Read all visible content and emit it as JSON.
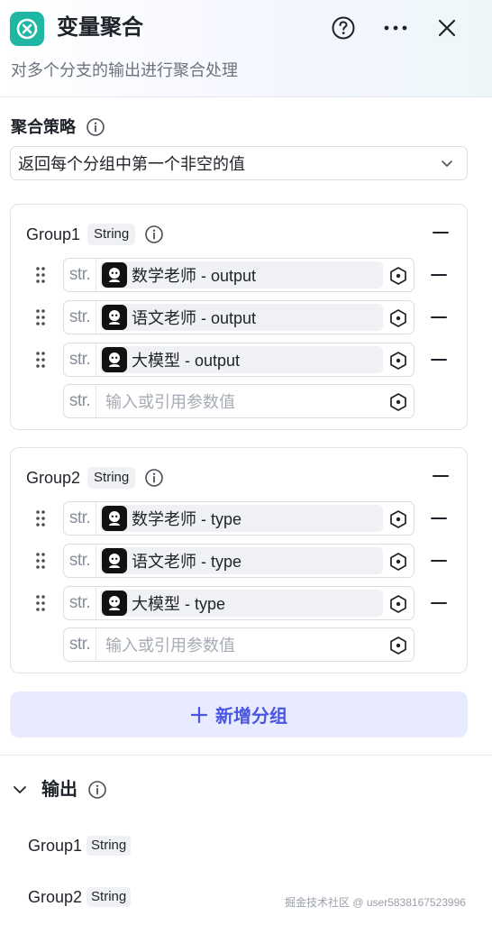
{
  "header": {
    "title": "变量聚合",
    "description": "对多个分支的输出进行聚合处理",
    "accent_color": "#1fb7a4"
  },
  "strategy": {
    "label": "聚合策略",
    "selected": "返回每个分组中第一个非空的值"
  },
  "groups": [
    {
      "name": "Group1",
      "type": "String",
      "variables": [
        {
          "type_abbr": "str.",
          "node": "数学老师",
          "sep": " - ",
          "field": "output"
        },
        {
          "type_abbr": "str.",
          "node": "语文老师",
          "sep": " - ",
          "field": "output"
        },
        {
          "type_abbr": "str.",
          "node": "大模型",
          "sep": " - ",
          "field": "output"
        }
      ],
      "empty_input": {
        "type_abbr": "str.",
        "placeholder": "输入或引用参数值"
      }
    },
    {
      "name": "Group2",
      "type": "String",
      "variables": [
        {
          "type_abbr": "str.",
          "node": "数学老师",
          "sep": " - ",
          "field": "type"
        },
        {
          "type_abbr": "str.",
          "node": "语文老师",
          "sep": " - ",
          "field": "type"
        },
        {
          "type_abbr": "str.",
          "node": "大模型",
          "sep": " - ",
          "field": "type"
        }
      ],
      "empty_input": {
        "type_abbr": "str.",
        "placeholder": "输入或引用参数值"
      }
    }
  ],
  "add_group_label": "新增分组",
  "output": {
    "label": "输出",
    "items": [
      {
        "name": "Group1",
        "type": "String"
      },
      {
        "name": "Group2",
        "type": "String"
      }
    ]
  },
  "watermark": "掘金技术社区 @ user5838167523996"
}
